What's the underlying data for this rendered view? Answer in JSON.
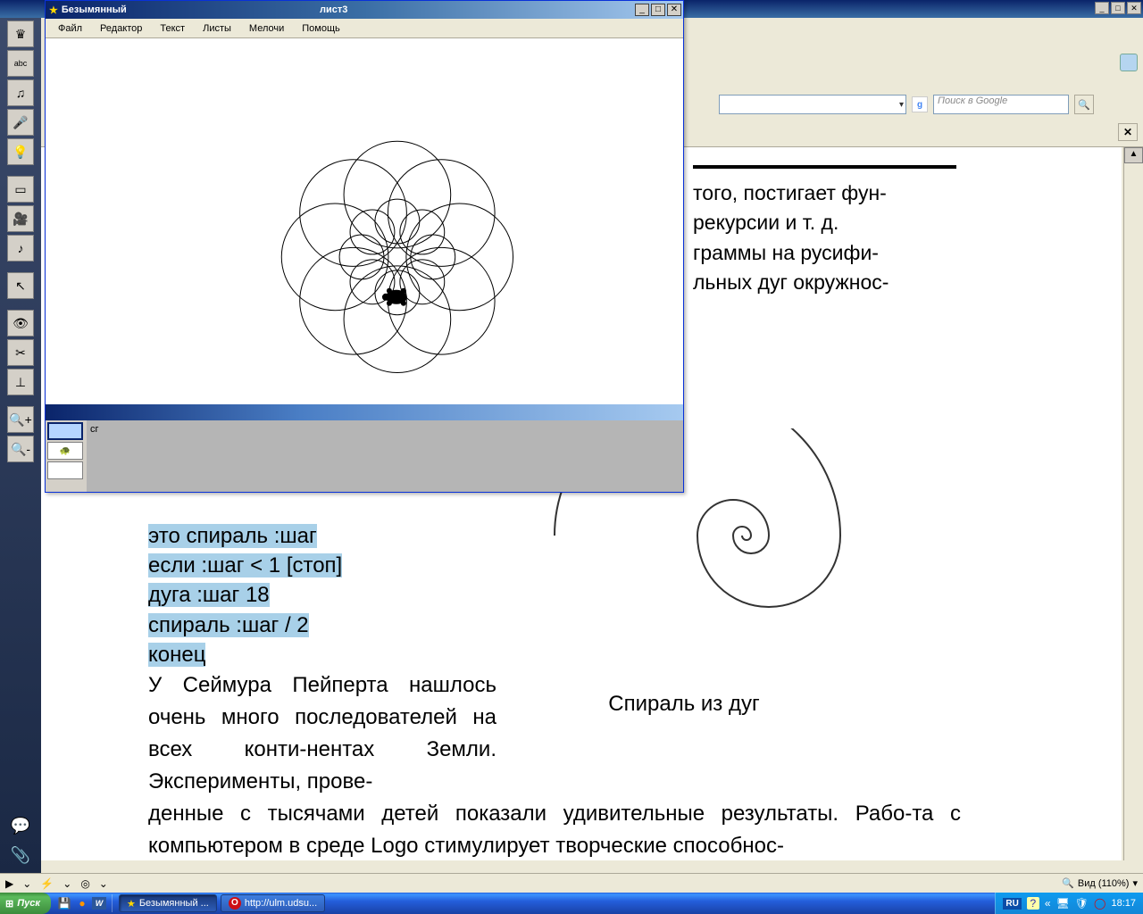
{
  "bg_window": {
    "win_btns": [
      "_",
      "□",
      "✕"
    ]
  },
  "search": {
    "placeholder": "Поиск в Google"
  },
  "doc": {
    "top_text_lines": [
      "того, постигает фун-",
      "рекурсии и т. д.",
      "граммы на  русифи-",
      "льных дуг окружнос-"
    ],
    "code": {
      "l1": "это спираль :шаг",
      "l2": "   если :шаг < 1 [стоп]",
      "l3": "   дуга :шаг 18",
      "l4": "   спираль :шаг / 2",
      "l5": "конец"
    },
    "body_top": "        У Сеймура Пейперта нашлось очень много последователей на всех конти-нентах Земли. Эксперименты, прове-",
    "body_wide": "денные с тысячами детей показали удивительные результаты. Рабо-та с компьютером в среде Logo стимулирует творческие способнос-",
    "spiral_caption": "Спираль из дуг"
  },
  "logo": {
    "title_left": "Безымянный",
    "title_center": "лист3",
    "win_btns": [
      "_",
      "□",
      "✕"
    ],
    "menu": [
      "Файл",
      "Редактор",
      "Текст",
      "Листы",
      "Мелочи",
      "Помощь"
    ],
    "cmd_label": "сг"
  },
  "statusbar": {
    "zoom": "Вид (110%)"
  },
  "taskbar": {
    "start": "Пуск",
    "tasks": [
      {
        "icon": "★",
        "label": "Безымянный ..."
      },
      {
        "icon": "O",
        "label": "http://ulm.udsu..."
      }
    ],
    "lang": "RU",
    "clock": "18:17"
  }
}
